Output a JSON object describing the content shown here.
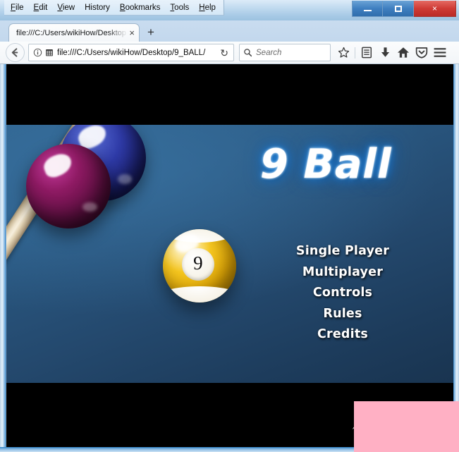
{
  "window": {
    "menubar": [
      {
        "label": "File",
        "accel": "F"
      },
      {
        "label": "Edit",
        "accel": "E"
      },
      {
        "label": "View",
        "accel": "V"
      },
      {
        "label": "History",
        "accel": ""
      },
      {
        "label": "Bookmarks",
        "accel": "B"
      },
      {
        "label": "Tools",
        "accel": "T"
      },
      {
        "label": "Help",
        "accel": "H"
      }
    ],
    "controls": {
      "minimize_label": "Minimize",
      "maximize_label": "Restore",
      "close_label": "×",
      "close_color": "#c4342e"
    }
  },
  "tabs": {
    "active": {
      "title": "file:///C:/Users/wikiHow/Desktop",
      "close_label": "×"
    },
    "newtab_label": "+"
  },
  "navbar": {
    "back_label": "←",
    "identity_icon": "info-icon",
    "page_icon": "document-icon",
    "url": "file:///C:/Users/wikiHow/Desktop/9_BALL/",
    "reload_label": "↻",
    "search_placeholder": "Search",
    "icons": [
      {
        "name": "bookmark-star-icon"
      },
      {
        "name": "library-icon"
      },
      {
        "name": "downloads-icon"
      },
      {
        "name": "home-icon"
      },
      {
        "name": "pocket-shield-icon"
      },
      {
        "name": "hamburger-menu-icon"
      }
    ]
  },
  "game": {
    "title": "9 Ball",
    "title_glow_color": "#2f8fe0",
    "background_top_color": "#2c5f8a",
    "background_bottom_color": "#193450",
    "letterbox_color": "#000000",
    "menu_items": [
      {
        "label": "Single Player"
      },
      {
        "label": "Multiplayer"
      },
      {
        "label": "Controls"
      },
      {
        "label": "Rules"
      },
      {
        "label": "Credits"
      }
    ],
    "balls": [
      {
        "name": "blue-ball",
        "number": "",
        "color": "#2f3ba8"
      },
      {
        "name": "purple-ball",
        "number": "",
        "color": "#8e1a63"
      },
      {
        "name": "nine-ball",
        "number": "9",
        "color": "#f5c61f"
      }
    ],
    "cue_stick": {
      "name": "cue-stick",
      "color": "#efe4cd"
    }
  },
  "overlay": {
    "pink_rect_color": "#ffb0c4"
  }
}
